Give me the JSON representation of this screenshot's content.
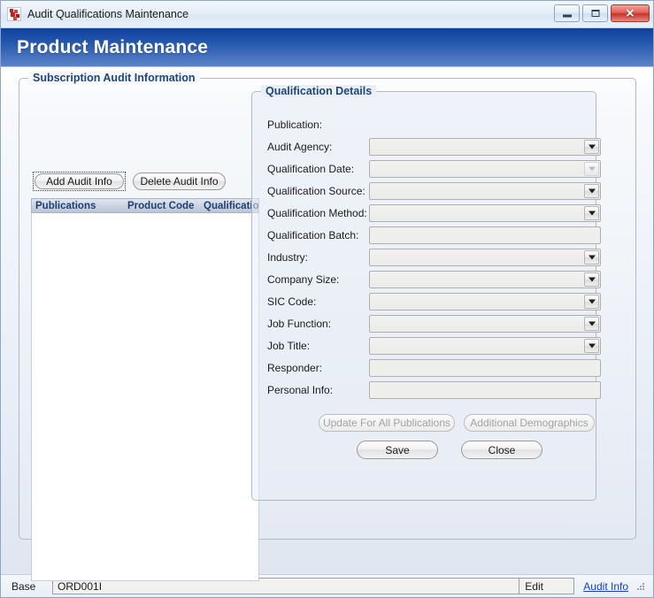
{
  "window": {
    "title": "Audit Qualifications Maintenance",
    "icon": "app-icon",
    "controls": {
      "minimize": "minimize-button",
      "maximize": "maximize-button",
      "close_glyph": "✕"
    }
  },
  "banner": {
    "title": "Product Maintenance"
  },
  "outer_group": {
    "title": "Subscription Audit Information",
    "buttons": {
      "add": "Add Audit Info",
      "delete": "Delete Audit Info"
    },
    "grid": {
      "columns": [
        "Publications",
        "Product Code",
        "Qualification"
      ],
      "rows": []
    }
  },
  "details_group": {
    "title": "Qualification Details",
    "fields": [
      {
        "label": "Publication:",
        "type": "text-static",
        "value": ""
      },
      {
        "label": "Audit Agency:",
        "type": "combo",
        "value": "",
        "enabled": true
      },
      {
        "label": "Qualification Date:",
        "type": "combo",
        "value": "",
        "enabled": false
      },
      {
        "label": "Qualification Source:",
        "type": "combo",
        "value": "",
        "enabled": true
      },
      {
        "label": "Qualification Method:",
        "type": "combo",
        "value": "",
        "enabled": true
      },
      {
        "label": "Qualification Batch:",
        "type": "textbox",
        "value": ""
      },
      {
        "label": "Industry:",
        "type": "combo",
        "value": "",
        "enabled": true
      },
      {
        "label": "Company Size:",
        "type": "combo",
        "value": "",
        "enabled": true
      },
      {
        "label": "SIC Code:",
        "type": "combo",
        "value": "",
        "enabled": true
      },
      {
        "label": "Job Function:",
        "type": "combo",
        "value": "",
        "enabled": true
      },
      {
        "label": "Job Title:",
        "type": "combo",
        "value": "",
        "enabled": true
      },
      {
        "label": "Responder:",
        "type": "textbox",
        "value": ""
      },
      {
        "label": "Personal Info:",
        "type": "textbox",
        "value": ""
      }
    ],
    "actions": {
      "update_all": "Update For All Publications",
      "additional_demographics": "Additional Demographics",
      "save": "Save",
      "close": "Close"
    }
  },
  "statusbar": {
    "base_label": "Base",
    "base_value": "ORD001I",
    "mode": "Edit",
    "link": "Audit Info"
  },
  "colors": {
    "banner_start": "#10429c",
    "banner_end": "#5c83c8",
    "group_title": "#21457e",
    "grid_header_text": "#1f3f73",
    "link": "#1340c8",
    "close_button": "#c6342a"
  }
}
